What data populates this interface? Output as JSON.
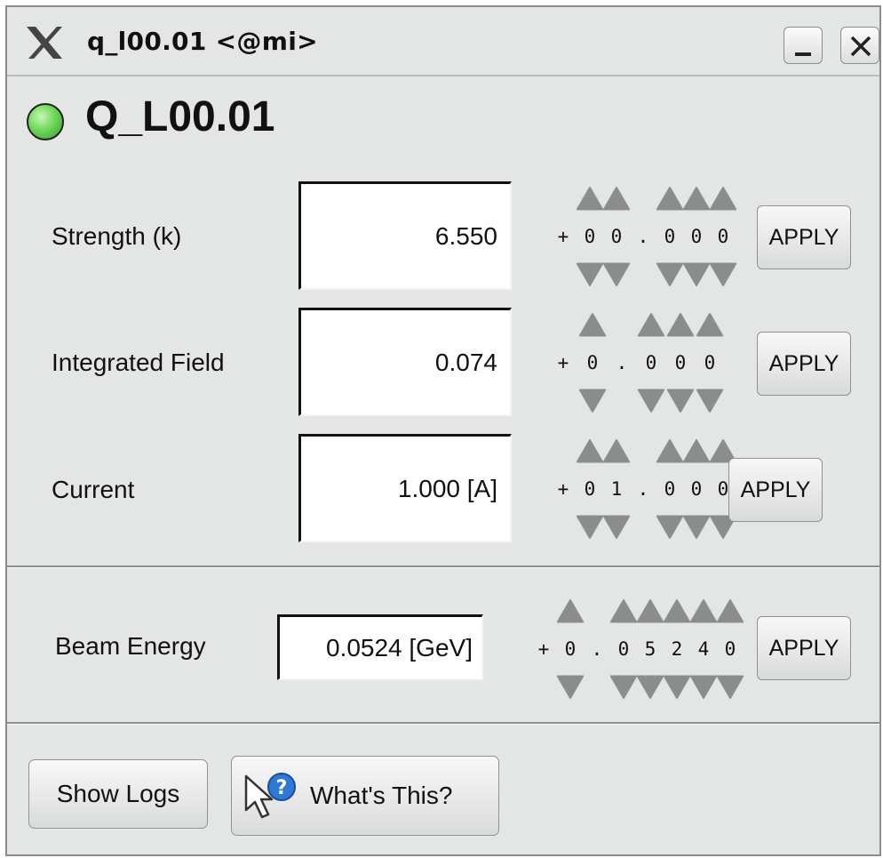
{
  "window": {
    "title": "q_l00.01 <@mi>"
  },
  "device": {
    "name": "Q_L00.01",
    "status_color": "#5ccf4a"
  },
  "rows": [
    {
      "label": "Strength (k)",
      "value": "6.550",
      "digits": [
        "+",
        "0",
        "0",
        ".",
        "0",
        "0",
        "0"
      ],
      "apply": "APPLY"
    },
    {
      "label": "Integrated Field",
      "value": "0.074",
      "digits": [
        "+",
        "0",
        ".",
        "0",
        "0",
        "0"
      ],
      "apply": "APPLY"
    },
    {
      "label": "Current",
      "value": "1.000 [A]",
      "digits": [
        "+",
        "0",
        "1",
        ".",
        "0",
        "0",
        "0"
      ],
      "apply": "APPLY"
    }
  ],
  "beam": {
    "label": "Beam Energy",
    "value": "0.0524 [GeV]",
    "digits": [
      "+",
      "0",
      ".",
      "0",
      "5",
      "2",
      "4",
      "0"
    ],
    "apply": "APPLY"
  },
  "footer": {
    "show_logs": "Show Logs",
    "whats_this": "What's This?"
  },
  "icons": {
    "logo": "x-logo-icon",
    "minimize": "minimize-icon",
    "close": "close-icon",
    "help": "whats-this-icon"
  }
}
